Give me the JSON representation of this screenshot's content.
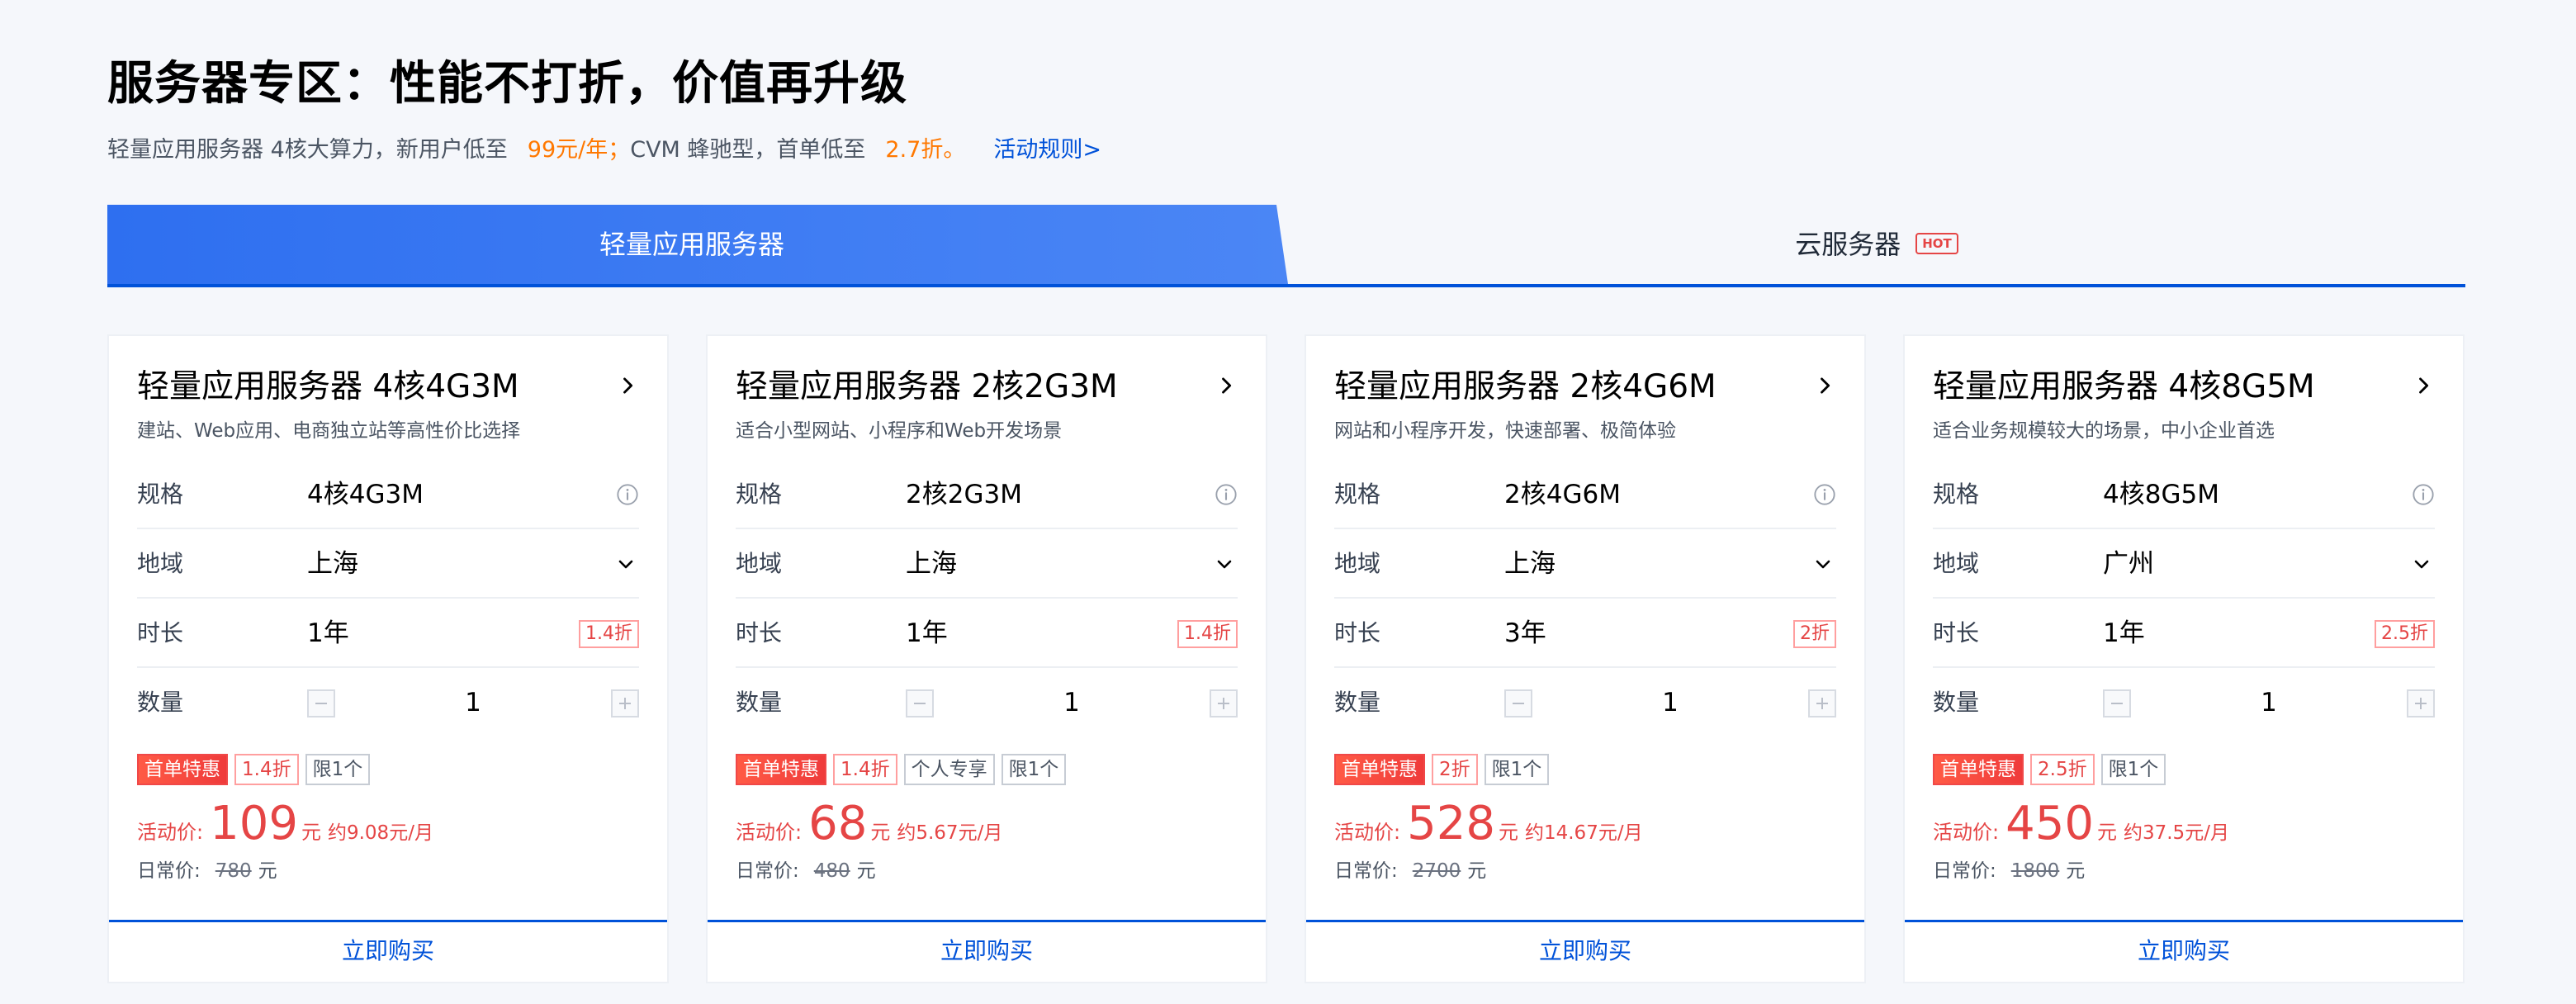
{
  "header": {
    "title": "服务器专区：性能不打折，价值再升级",
    "subtitle_part1": "轻量应用服务器 4核大算力，新用户低至",
    "subtitle_highlight1": "99元/年",
    "subtitle_sep": "；",
    "subtitle_part2": "CVM 蜂驰型，首单低至",
    "subtitle_highlight2": "2.7折。",
    "rules_link": "活动规则>"
  },
  "tabs": [
    {
      "label": "轻量应用服务器",
      "active": true
    },
    {
      "label": "云服务器",
      "badge": "HOT",
      "active": false
    }
  ],
  "row_labels": {
    "spec": "规格",
    "region": "地域",
    "duration": "时长",
    "quantity": "数量"
  },
  "price_labels": {
    "activity": "活动价:",
    "regular": "日常价:",
    "unit": "元"
  },
  "buy_label": "立即购买",
  "colors": {
    "brand_blue": "#0052d9",
    "price_red": "#e54545",
    "highlight_orange": "#ff7800"
  },
  "cards": [
    {
      "title": "轻量应用服务器 4核4G3M",
      "desc": "建站、Web应用、电商独立站等高性价比选择",
      "spec": "4核4G3M",
      "region": "上海",
      "duration": "1年",
      "duration_discount": "1.4折",
      "quantity": "1",
      "tags": [
        {
          "text": "首单特惠",
          "style": "solid"
        },
        {
          "text": "1.4折",
          "style": "outline-red"
        },
        {
          "text": "限1个",
          "style": "outline-gray"
        }
      ],
      "price": "109",
      "monthly": "约9.08元/月",
      "regular_price": "780"
    },
    {
      "title": "轻量应用服务器 2核2G3M",
      "desc": "适合小型网站、小程序和Web开发场景",
      "spec": "2核2G3M",
      "region": "上海",
      "duration": "1年",
      "duration_discount": "1.4折",
      "quantity": "1",
      "tags": [
        {
          "text": "首单特惠",
          "style": "solid"
        },
        {
          "text": "1.4折",
          "style": "outline-red"
        },
        {
          "text": "个人专享",
          "style": "outline-gray"
        },
        {
          "text": "限1个",
          "style": "outline-gray"
        }
      ],
      "price": "68",
      "monthly": "约5.67元/月",
      "regular_price": "480"
    },
    {
      "title": "轻量应用服务器 2核4G6M",
      "desc": "网站和小程序开发，快速部署、极简体验",
      "spec": "2核4G6M",
      "region": "上海",
      "duration": "3年",
      "duration_discount": "2折",
      "quantity": "1",
      "tags": [
        {
          "text": "首单特惠",
          "style": "solid"
        },
        {
          "text": "2折",
          "style": "outline-red"
        },
        {
          "text": "限1个",
          "style": "outline-gray"
        }
      ],
      "price": "528",
      "monthly": "约14.67元/月",
      "regular_price": "2700"
    },
    {
      "title": "轻量应用服务器 4核8G5M",
      "desc": "适合业务规模较大的场景，中小企业首选",
      "spec": "4核8G5M",
      "region": "广州",
      "duration": "1年",
      "duration_discount": "2.5折",
      "quantity": "1",
      "tags": [
        {
          "text": "首单特惠",
          "style": "solid"
        },
        {
          "text": "2.5折",
          "style": "outline-red"
        },
        {
          "text": "限1个",
          "style": "outline-gray"
        }
      ],
      "price": "450",
      "monthly": "约37.5元/月",
      "regular_price": "1800"
    }
  ]
}
